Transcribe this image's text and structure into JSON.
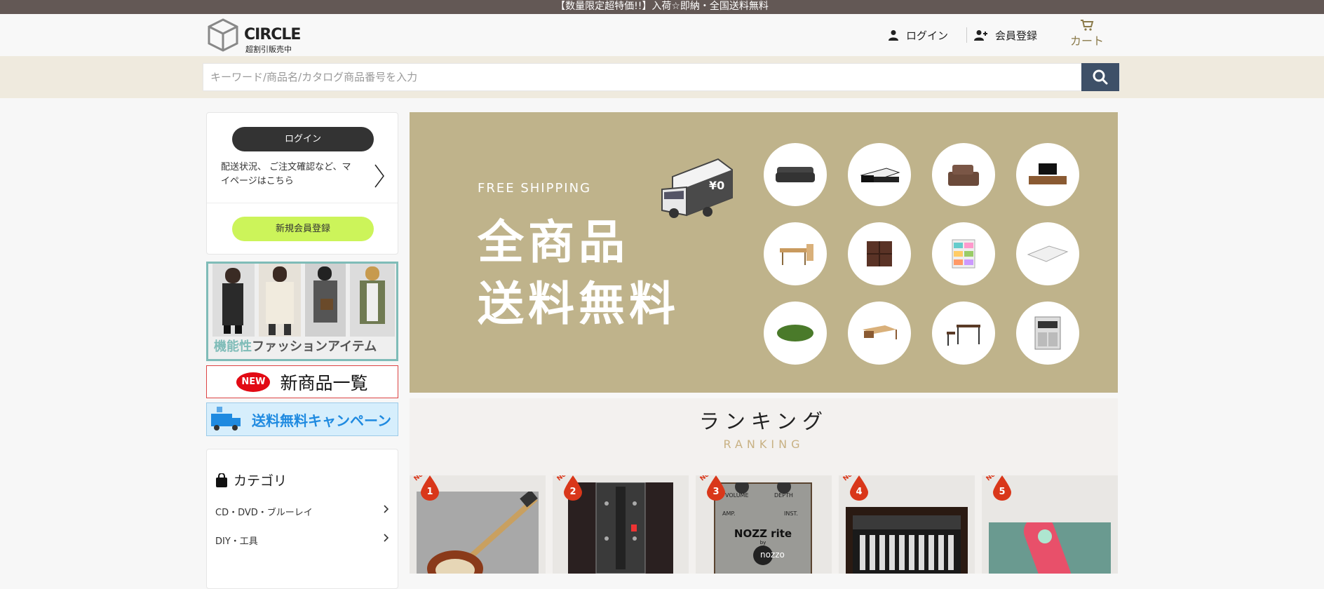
{
  "announcement": "【数量限定超特価!!】入荷☆即納・全国送料無料",
  "header": {
    "logo_brand": "CIRCLE",
    "logo_tagline": "超割引販売中",
    "login_label": "ログイン",
    "register_label": "会員登録",
    "cart_label": "カート",
    "cart_count": ""
  },
  "search": {
    "placeholder": "キーワード/商品名/カタログ商品番号を入力",
    "value": ""
  },
  "sidebar": {
    "login_button": "ログイン",
    "mypage_text": "配送状況、 ご注文確認など、マイページはこちら",
    "register_button": "新規会員登録",
    "fashion_banner": {
      "highlight": "機能性",
      "text": "ファッションアイテム"
    },
    "new_banner": {
      "badge": "NEW",
      "text": "新商品一覧"
    },
    "shipping_banner": "送料無料キャンペーン",
    "category_title": "カテゴリ",
    "categories": [
      {
        "label": "CD・DVD・ブルーレイ"
      },
      {
        "label": "DIY・工具"
      }
    ]
  },
  "hero": {
    "kicker": "FREE SHIPPING",
    "line1": "全商品",
    "line2": "送料無料",
    "truck_sign": "¥0",
    "products": [
      "sofa",
      "bed",
      "cushion-set",
      "tv-stand",
      "dining-set",
      "cube-shelf",
      "color-drawer",
      "mattress",
      "rug",
      "low-table",
      "desk-set",
      "kitchen-cabinet"
    ]
  },
  "ranking": {
    "title": "ランキング",
    "subtitle": "RANKING",
    "no_label": "No.",
    "items": [
      {
        "rank": "1",
        "image": "electric-guitar"
      },
      {
        "rank": "2",
        "image": "pedal-board"
      },
      {
        "rank": "3",
        "image": "effects-pedal",
        "pedal_top_left": "VOLUME",
        "pedal_top_right": "DEPTH",
        "pedal_mid_left": "AMP.",
        "pedal_mid_right": "INST.",
        "pedal_name": "NOZZ rite",
        "pedal_by": "by",
        "pedal_brand": "nozzo"
      },
      {
        "rank": "4",
        "image": "accordion"
      },
      {
        "rank": "5",
        "image": "skateboard"
      }
    ]
  },
  "colors": {
    "topbar": "#635855",
    "search_band": "#efeade",
    "search_button": "#3e5068",
    "hero_bg": "#bfb38b",
    "register_green": "#ccf45a",
    "ranking_accent": "#d9371a",
    "ranking_sub": "#c8b183"
  }
}
